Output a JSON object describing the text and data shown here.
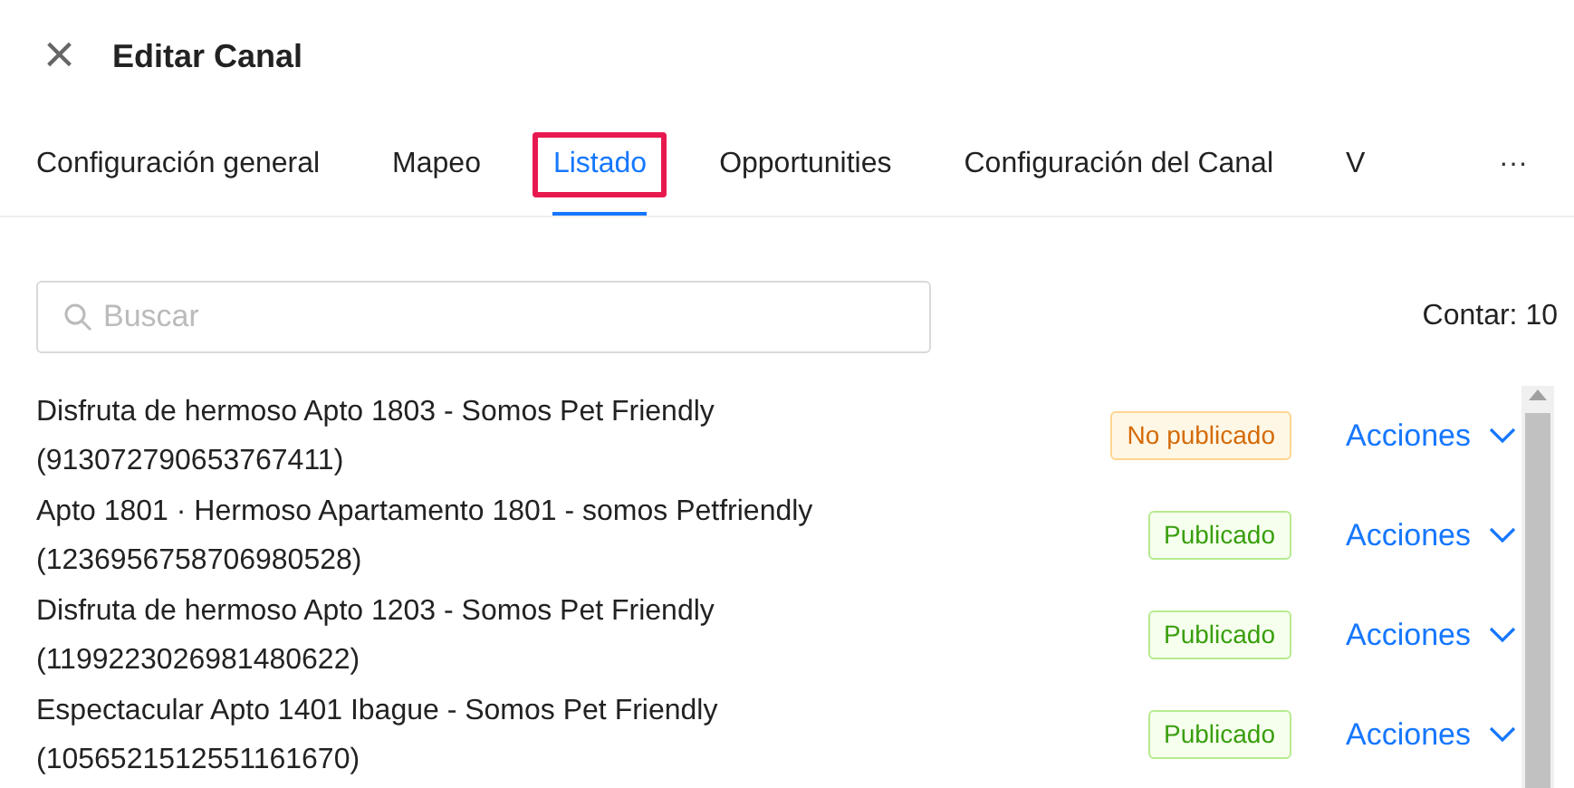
{
  "dialog": {
    "title": "Editar Canal",
    "close_icon": "×"
  },
  "tabs": [
    {
      "label": "Configuración general",
      "selected": false,
      "highlighted": false
    },
    {
      "label": "Mapeo",
      "selected": false,
      "highlighted": false
    },
    {
      "label": "Listado",
      "selected": true,
      "highlighted": true
    },
    {
      "label": "Opportunities",
      "selected": false,
      "highlighted": false
    },
    {
      "label": "Configuración del Canal",
      "selected": false,
      "highlighted": false
    },
    {
      "label": "V",
      "selected": false,
      "highlighted": false
    }
  ],
  "more_tabs": "···",
  "search": {
    "placeholder": "Buscar"
  },
  "count": "Contar: 10",
  "listings": [
    {
      "title": "Disfruta de hermoso Apto 1803 - Somos Pet Friendly",
      "id": "(913072790653767411)",
      "status": "No publicado",
      "kind": "unpublished",
      "action": "Acciones"
    },
    {
      "title": "Apto 1801 · Hermoso Apartamento 1801 - somos Petfriendly",
      "id": "(1236956758706980528)",
      "status": "Publicado",
      "kind": "published",
      "action": "Acciones"
    },
    {
      "title": "Disfruta de hermoso Apto 1203 - Somos Pet Friendly",
      "id": "(1199223026981480622)",
      "status": "Publicado",
      "kind": "published",
      "action": "Acciones"
    },
    {
      "title": "Espectacular Apto 1401 Ibague - Somos Pet Friendly",
      "id": "(1056521512551161670)",
      "status": "Publicado",
      "kind": "published",
      "action": "Acciones"
    }
  ]
}
